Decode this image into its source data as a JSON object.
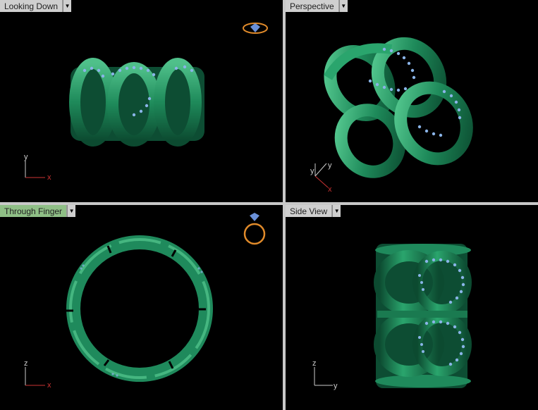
{
  "viewports": [
    {
      "label": "Looking Down",
      "active": false,
      "axis_v": "y",
      "axis_h": "x"
    },
    {
      "label": "Perspective",
      "active": false,
      "axis_v": "y",
      "axis_h": "x"
    },
    {
      "label": "Through Finger",
      "active": true,
      "axis_v": "z",
      "axis_h": "x"
    },
    {
      "label": "Side View",
      "active": false,
      "axis_v": "z",
      "axis_h": "y"
    }
  ],
  "dropdown_icon": "triangle-down-icon",
  "colors": {
    "ring": "#1f8a5c",
    "gem": "#8ab4e8",
    "background": "#000000",
    "active_tab": "#8fbf86"
  }
}
